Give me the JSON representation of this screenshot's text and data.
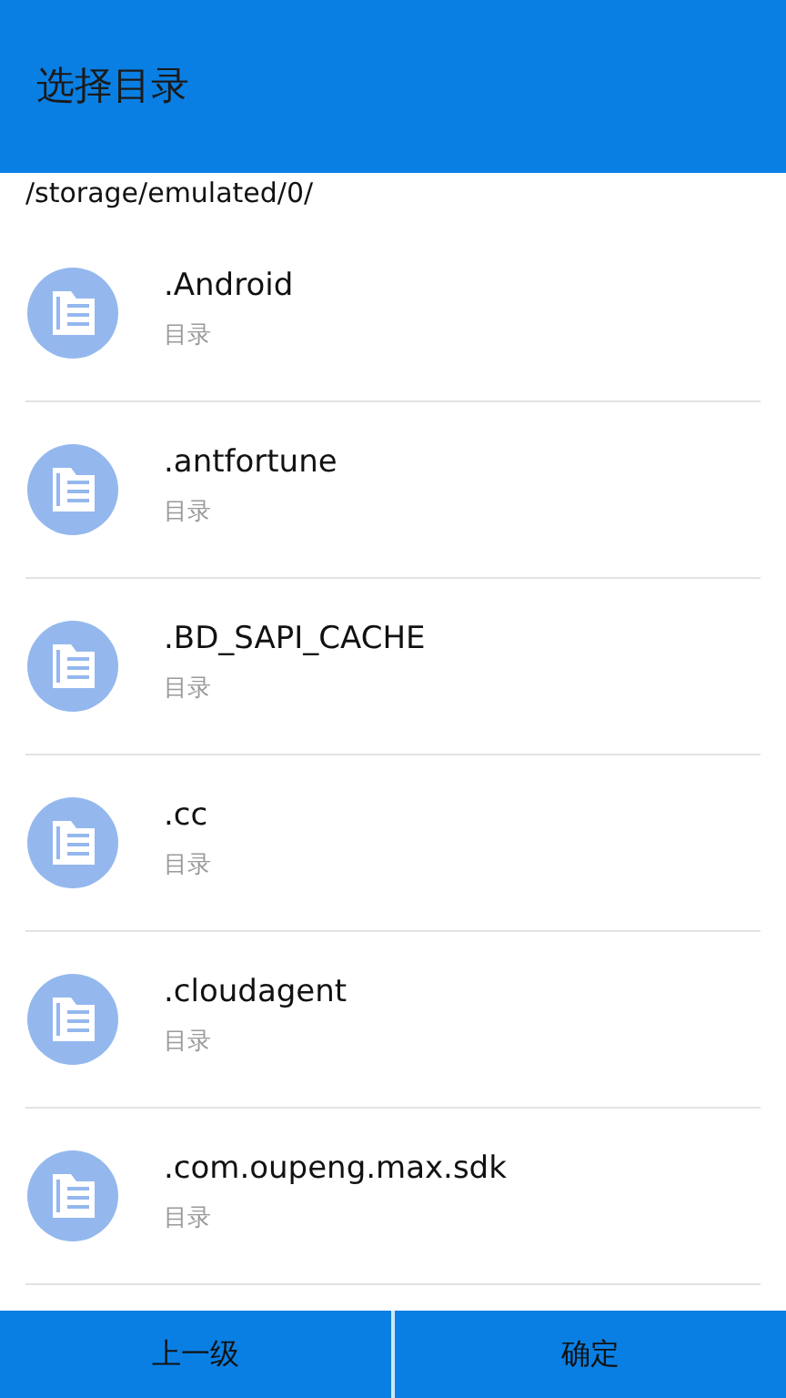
{
  "header": {
    "title": "选择目录"
  },
  "path": "/storage/emulated/0/",
  "items": [
    {
      "name": ".Android",
      "type": "目录"
    },
    {
      "name": ".antfortune",
      "type": "目录"
    },
    {
      "name": ".BD_SAPI_CACHE",
      "type": "目录"
    },
    {
      "name": ".cc",
      "type": "目录"
    },
    {
      "name": ".cloudagent",
      "type": "目录"
    },
    {
      "name": ".com.oupeng.max.sdk",
      "type": "目录"
    }
  ],
  "buttons": [
    "上一级",
    "确定"
  ]
}
